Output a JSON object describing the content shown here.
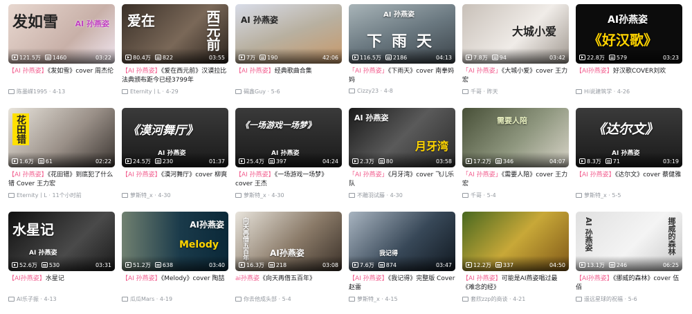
{
  "colors": {
    "tag": "#f25d8e",
    "title": "#18191c",
    "meta": "#9499a0"
  },
  "icons": {
    "play": "play-count-icon",
    "danmaku": "danmaku-count-icon",
    "uploader": "uploader-icon"
  },
  "videos": [
    {
      "thumb_text": "发如雪",
      "thumb_sub": "AI 孙燕姿",
      "plays": "121.5万",
      "danmaku": "1460",
      "duration": "03:22",
      "tag": "【AI 孙燕姿】",
      "title": "《发如雪》cover 周杰伦",
      "uploader": "陈墨嵘1995",
      "date": "4-13",
      "bg": "linear-gradient(135deg,#e8d8d0,#c8b0a8 60%,#f0e6f0)"
    },
    {
      "thumb_text": "爱在",
      "thumb_sub": "西元前",
      "plays": "80.4万",
      "danmaku": "822",
      "duration": "03:55",
      "tag": "【AI 孙燕姿】",
      "title": "《爱在西元前》汉谟拉比法典颁布距今已经3799年",
      "uploader": "Eternity丨L",
      "date": "4-29",
      "bg": "linear-gradient(135deg,#3a3028,#7a6858 55%,#2a221c)"
    },
    {
      "thumb_text": "AI 孙燕姿",
      "thumb_sub": "",
      "plays": "7万",
      "danmaku": "190",
      "duration": "42:06",
      "tag": "【AI 孙燕姿】",
      "title": "经典歌曲合集",
      "uploader": "碣鑫Guy",
      "date": "5-6",
      "bg": "linear-gradient(160deg,#d8dce8,#b8b0a0 50%,#c89868)"
    },
    {
      "thumb_text": "下雨天",
      "thumb_sub": "AI 孙燕姿",
      "plays": "116.5万",
      "danmaku": "2186",
      "duration": "04:13",
      "tag": "「AI 孙燕姿」",
      "title": "《下雨天》cover 南拳妈妈",
      "uploader": "Cizzy23",
      "date": "4-8",
      "bg": "linear-gradient(160deg,#a8b4b8,#6a7880 50%,#3a4248)"
    },
    {
      "thumb_text": "大城小爱",
      "thumb_sub": "",
      "plays": "7.8万",
      "danmaku": "94",
      "duration": "03:42",
      "tag": "「AI 孙燕姿」",
      "title": "《大城小爱》cover 王力宏",
      "uploader": "千哥",
      "date": "昨天",
      "bg": "linear-gradient(135deg,#c8c0b8,#f0ece8 55%,#a09890)"
    },
    {
      "thumb_text": "AI孙燕姿",
      "thumb_sub": "《好汉歌》",
      "plays": "22.8万",
      "danmaku": "579",
      "duration": "03:23",
      "tag": "【AI孙燕姿】",
      "title": "好汉歌COVER刘欢",
      "uploader": "Hi说建筑学",
      "date": "4-26",
      "bg": "#0c0c0c"
    },
    {
      "thumb_text": "花田错",
      "thumb_sub": "",
      "plays": "1.6万",
      "danmaku": "61",
      "duration": "02:22",
      "tag": "【AI 孙燕姿】",
      "title": "《花田错》到底犯了什么错 Cover 王力宏",
      "uploader": "Eternity丨L",
      "date": "11个小时前",
      "bg": "linear-gradient(135deg,#e8e4dc,#9a9088 55%,#3a3430)"
    },
    {
      "thumb_text": "《漠河舞厅》",
      "thumb_sub": "AI 孙燕姿",
      "plays": "24.5万",
      "danmaku": "230",
      "duration": "01:37",
      "tag": "【AI 孙燕姿】",
      "title": "《漠河舞厅》cover 柳爽",
      "uploader": "萝斯特_x",
      "date": "4-30",
      "bg": "linear-gradient(180deg,#3a3a3a,#1a1a1a)"
    },
    {
      "thumb_text": "《一场游戏一场梦》",
      "thumb_sub": "AI 孙燕姿",
      "plays": "25.4万",
      "danmaku": "397",
      "duration": "04:24",
      "tag": "【AI 孙燕姿】",
      "title": "《一场游戏一场梦》cover 王杰",
      "uploader": "萝斯特_x",
      "date": "4-30",
      "bg": "linear-gradient(180deg,#3a3a3a,#1a1a1a)"
    },
    {
      "thumb_text": "月牙湾",
      "thumb_sub": "AI 孙燕姿",
      "plays": "2.3万",
      "danmaku": "80",
      "duration": "03:58",
      "tag": "「AI 孙燕姿」",
      "title": "《月牙湾》cover 飞儿乐队",
      "uploader": "不雕羽试藤",
      "date": "4-30",
      "bg": "linear-gradient(135deg,#1a1a1a,#5a5a5a 50%,#2a2a2a)"
    },
    {
      "thumb_text": "需要人陪",
      "thumb_sub": "",
      "plays": "17.2万",
      "danmaku": "346",
      "duration": "04:07",
      "tag": "「AI 孙燕姿」",
      "title": "《需要人陪》cover 王力宏",
      "uploader": "千哥",
      "date": "5-4",
      "bg": "linear-gradient(135deg,#485038,#909880 55%,#d8d4c8)"
    },
    {
      "thumb_text": "《达尔文》",
      "thumb_sub": "AI 孙燕姿",
      "plays": "8.3万",
      "danmaku": "71",
      "duration": "03:19",
      "tag": "【AI 孙燕姿】",
      "title": "《达尔文》cover 蔡健雅",
      "uploader": "萝斯特_x",
      "date": "5-5",
      "bg": "linear-gradient(180deg,#3a3a3a,#1a1a1a)"
    },
    {
      "thumb_text": "水星记",
      "thumb_sub": "AI 孙燕姿",
      "plays": "52.6万",
      "danmaku": "530",
      "duration": "03:31",
      "tag": "【AI孙燕姿】",
      "title": "水星记",
      "uploader": "AI乐子振",
      "date": "4-13",
      "bg": "linear-gradient(135deg,#101010,#4a4a4a 60%,#1a1a1a)"
    },
    {
      "thumb_text": "AI孙燕姿",
      "thumb_sub": "Melody",
      "plays": "51.2万",
      "danmaku": "638",
      "duration": "03:40",
      "tag": "【AI 孙燕姿】",
      "title": "《Melody》cover 陶喆",
      "uploader": "瓜瓜Mars",
      "date": "4-19",
      "bg": "linear-gradient(90deg,#708070,#1a3a4a 55%,#0a2838)"
    },
    {
      "thumb_text": "AI孙燕姿",
      "thumb_sub": "向天再借五百年",
      "plays": "16.3万",
      "danmaku": "218",
      "duration": "03:08",
      "tag": "ai孙燕姿",
      "title": "《向天再借五百年》",
      "uploader": "你去他成头部",
      "date": "5-4",
      "bg": "linear-gradient(135deg,#e8e4dc,#8a7a68 55%,#3a3028)"
    },
    {
      "thumb_text": "我记得",
      "thumb_sub": "",
      "plays": "7.6万",
      "danmaku": "874",
      "duration": "03:47",
      "tag": "【AI 孙燕姿】",
      "title": "《我记得》完整版 Cover 赵雷",
      "uploader": "萝斯特_x",
      "date": "4-15",
      "bg": "linear-gradient(135deg,#a8b4c0,#384858 55%,#101820)"
    },
    {
      "thumb_text": "",
      "thumb_sub": "",
      "plays": "12.2万",
      "danmaku": "337",
      "duration": "04:50",
      "tag": "【AI 孙燕姿】",
      "title": "可能是AI燕姿唱过最《难念的经》",
      "uploader": "套欣zzp的商谈",
      "date": "4-21",
      "bg": "linear-gradient(135deg,#486820,#c8a838 50%,#805818)"
    },
    {
      "thumb_text": "挪威的森林",
      "thumb_sub": "AI 孙燕姿",
      "plays": "13.1万",
      "danmaku": "246",
      "duration": "06:25",
      "tag": "【AI孙燕姿】",
      "title": "《挪威的森林》cover 伍佰",
      "uploader": "遥远星球的祝福",
      "date": "5-6",
      "bg": "linear-gradient(135deg,#e0e0e0,#f4f4f4 55%,#c8c8c8)"
    }
  ]
}
